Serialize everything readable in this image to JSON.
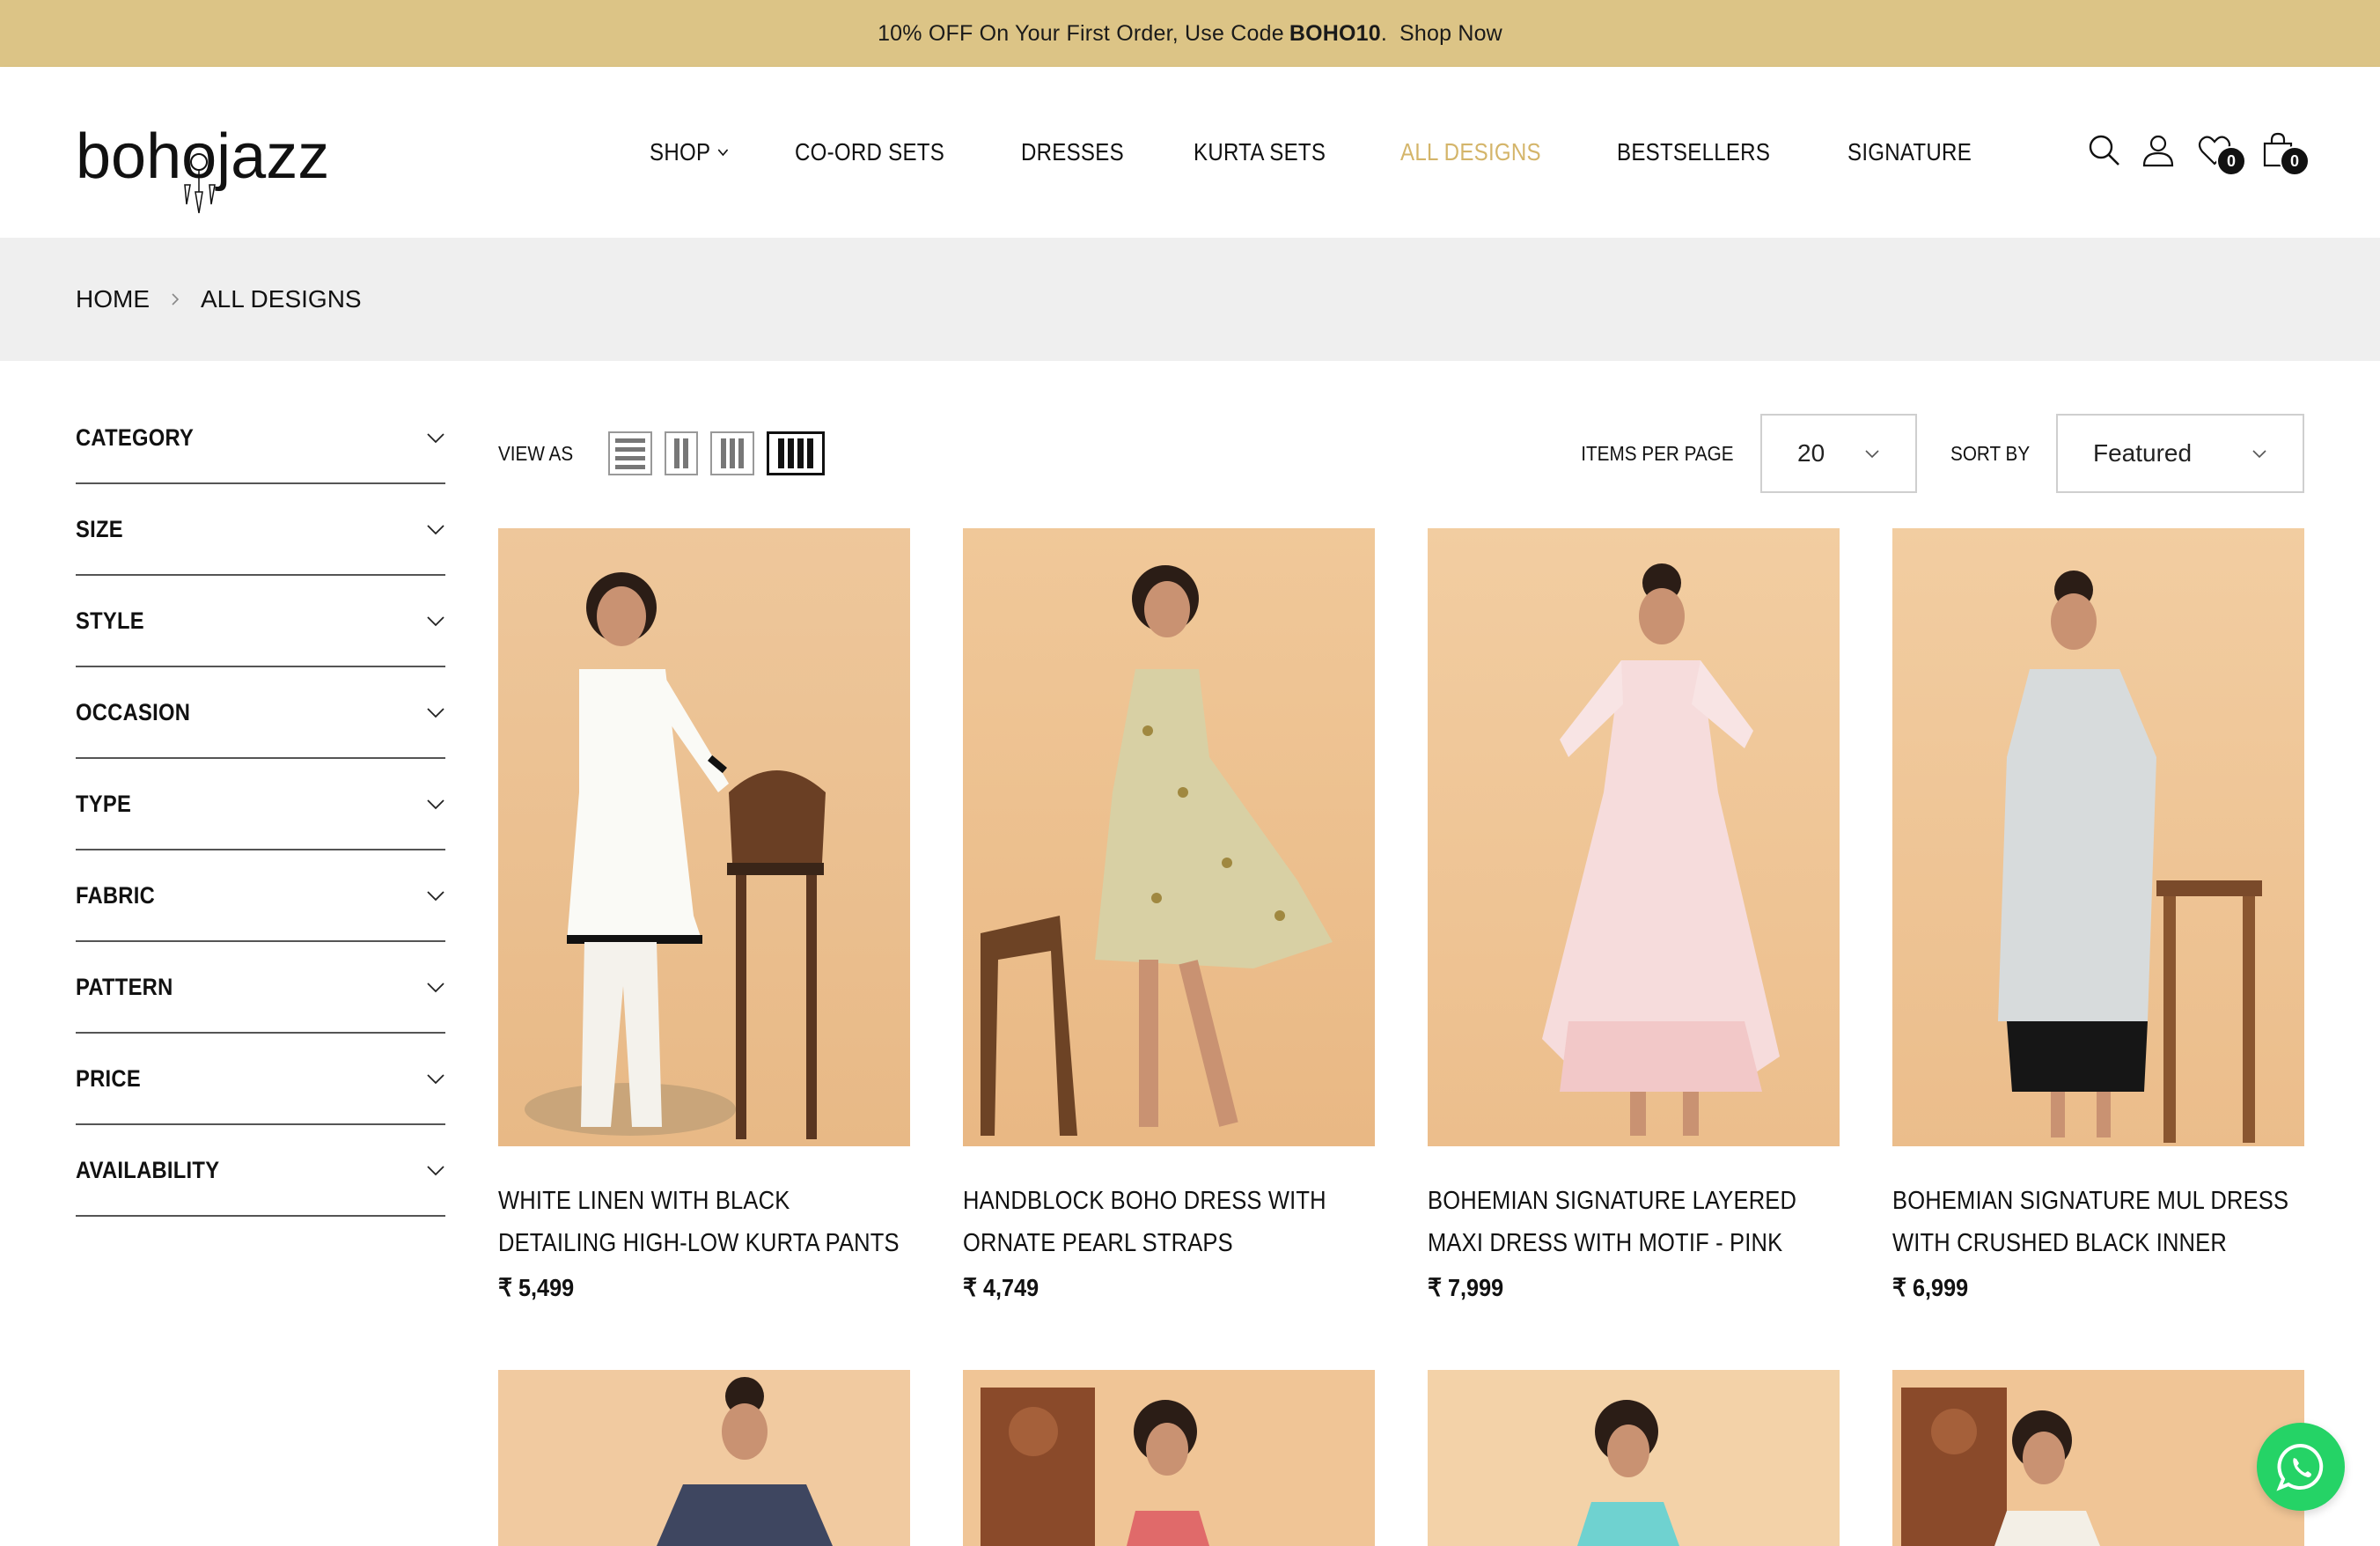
{
  "announcement": {
    "prefix": "10% OFF On Your First Order, Use Code",
    "code": "BOHO10",
    "suffix": ".",
    "link": "Shop Now"
  },
  "logo": {
    "text": "bohojazz"
  },
  "nav": {
    "items": [
      {
        "label": "SHOP",
        "has_dropdown": true
      },
      {
        "label": "CO-ORD SETS"
      },
      {
        "label": "DRESSES"
      },
      {
        "label": "KURTA SETS"
      },
      {
        "label": "ALL DESIGNS",
        "active": true
      },
      {
        "label": "BESTSELLERS"
      },
      {
        "label": "SIGNATURE"
      }
    ],
    "active_color": "#d4b56a"
  },
  "header_icons": {
    "search": "search-icon",
    "account": "user-icon",
    "wishlist": {
      "icon": "heart-icon",
      "count": "0"
    },
    "cart": {
      "icon": "bag-icon",
      "count": "0"
    }
  },
  "breadcrumb": {
    "home": "HOME",
    "current": "ALL DESIGNS"
  },
  "filters": [
    "CATEGORY",
    "SIZE",
    "STYLE",
    "OCCASION",
    "TYPE",
    "FABRIC",
    "PATTERN",
    "PRICE",
    "AVAILABILITY"
  ],
  "toolbar": {
    "view_as_label": "VIEW AS",
    "items_per_page_label": "ITEMS PER PAGE",
    "items_per_page_value": "20",
    "sort_by_label": "SORT BY",
    "sort_by_value": "Featured"
  },
  "products": [
    {
      "name": "WHITE LINEN WITH BLACK DETAILING HIGH-LOW KURTA PANTS",
      "price": "₹ 5,499"
    },
    {
      "name": "HANDBLOCK BOHO DRESS WITH ORNATE PEARL STRAPS",
      "price": "₹ 4,749"
    },
    {
      "name": "BOHEMIAN SIGNATURE LAYERED MAXI DRESS WITH MOTIF - PINK",
      "price": "₹ 7,999"
    },
    {
      "name": "BOHEMIAN SIGNATURE MUL DRESS WITH CRUSHED BLACK INNER",
      "price": "₹ 6,999"
    }
  ],
  "colors": {
    "announcement_bg": "#dcc486",
    "photo_bg": "#efc89a",
    "whatsapp": "#25d366"
  }
}
